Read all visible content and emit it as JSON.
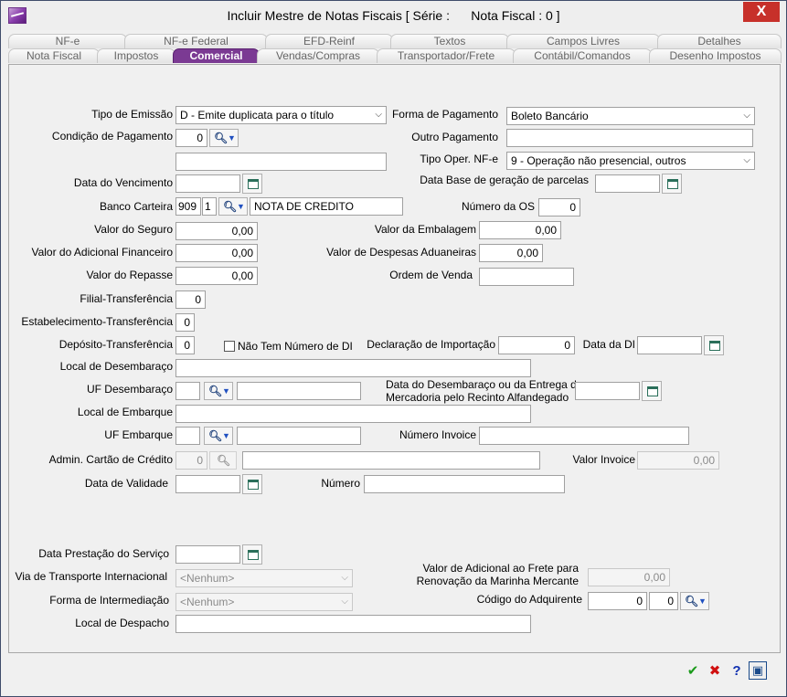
{
  "window": {
    "title": "Incluir Mestre de Notas Fiscais [ Série :      Nota Fiscal : 0 ]",
    "close": "X"
  },
  "tabs_row1": [
    "NF-e",
    "NF-e Federal",
    "EFD-Reinf",
    "Textos",
    "Campos Livres",
    "Detalhes"
  ],
  "tabs_row2": [
    "Nota Fiscal",
    "Impostos",
    "Comercial",
    "Vendas/Compras",
    "Transportador/Frete",
    "Contábil/Comandos",
    "Desenho Impostos"
  ],
  "form": {
    "tipo_emissao": {
      "label": "Tipo de Emissão",
      "value": "D - Emite duplicata para o título"
    },
    "forma_pagamento": {
      "label": "Forma de Pagamento",
      "value": "Boleto Bancário"
    },
    "condicao_pagamento": {
      "label": "Condição de Pagamento",
      "value": "0",
      "desc": ""
    },
    "outro_pagamento": {
      "label": "Outro Pagamento",
      "value": ""
    },
    "tipo_oper": {
      "label": "Tipo Oper. NF-e",
      "value": "9 - Operação não presencial, outros"
    },
    "data_vencimento": {
      "label": "Data do Vencimento",
      "value": ""
    },
    "data_base": {
      "label": "Data Base de geração de parcelas",
      "value": ""
    },
    "banco_carteira": {
      "label": "Banco Carteira",
      "banco": "909",
      "carteira": "1",
      "desc": "NOTA DE CREDITO"
    },
    "numero_os": {
      "label": "Número da OS",
      "value": "0"
    },
    "valor_seguro": {
      "label": "Valor do Seguro",
      "value": "0,00"
    },
    "valor_embalagem": {
      "label": "Valor da Embalagem",
      "value": "0,00"
    },
    "valor_adicional_financeiro": {
      "label": "Valor do Adicional Financeiro",
      "value": "0,00"
    },
    "valor_despesas_aduaneiras": {
      "label": "Valor de Despesas Aduaneiras",
      "value": "0,00"
    },
    "valor_repasse": {
      "label": "Valor do Repasse",
      "value": "0,00"
    },
    "ordem_venda": {
      "label": "Ordem de Venda",
      "value": ""
    },
    "filial_transferencia": {
      "label": "Filial-Transferência",
      "value": "0"
    },
    "estabelecimento_transferencia": {
      "label": "Estabelecimento-Transferência",
      "value": "0"
    },
    "deposito_transferencia": {
      "label": "Depósito-Transferência",
      "value": "0"
    },
    "nao_tem_numero_di": {
      "label": "Não Tem Número de DI",
      "checked": false
    },
    "declaracao_importacao": {
      "label": "Declaração de Importação",
      "value": "0"
    },
    "data_di": {
      "label": "Data da DI",
      "value": ""
    },
    "local_desembaraco": {
      "label": "Local de Desembaraço",
      "value": ""
    },
    "uf_desembaraco": {
      "label": "UF Desembaraço",
      "value": "",
      "desc": ""
    },
    "data_desembaraco": {
      "label1": "Data do Desembaraço ou da Entrega da",
      "label2": "Mercadoria pelo Recinto Alfandegado",
      "value": ""
    },
    "local_embarque": {
      "label": "Local de Embarque",
      "value": ""
    },
    "uf_embarque": {
      "label": "UF Embarque",
      "value": "",
      "desc": ""
    },
    "numero_invoice": {
      "label": "Número Invoice",
      "value": ""
    },
    "admin_cartao": {
      "label": "Admin. Cartão de Crédito",
      "value": "0",
      "desc": ""
    },
    "valor_invoice": {
      "label": "Valor Invoice",
      "value": "0,00"
    },
    "data_validade": {
      "label": "Data de Validade",
      "value": ""
    },
    "numero": {
      "label": "Número",
      "value": ""
    },
    "data_prestacao": {
      "label": "Data Prestação do Serviço",
      "value": ""
    },
    "via_transporte": {
      "label": "Via de Transporte Internacional",
      "value": "<Nenhum>"
    },
    "valor_adicional_frete": {
      "label1": "Valor de Adicional ao Frete para",
      "label2": "Renovação da Marinha Mercante",
      "value": "0,00"
    },
    "forma_intermediacao": {
      "label": "Forma de Intermediação",
      "value": "<Nenhum>"
    },
    "codigo_adquirente": {
      "label": "Código do Adquirente",
      "value1": "0",
      "value2": "0"
    },
    "local_despacho": {
      "label": "Local de Despacho",
      "value": ""
    }
  },
  "buttons": {
    "ok": "✔",
    "cancel": "✖",
    "help": "?",
    "print": "▣"
  },
  "colors": {
    "active_tab": "#7b3a93",
    "ok": "#1a9a1a",
    "cancel": "#d01010",
    "help": "#1030b0"
  }
}
